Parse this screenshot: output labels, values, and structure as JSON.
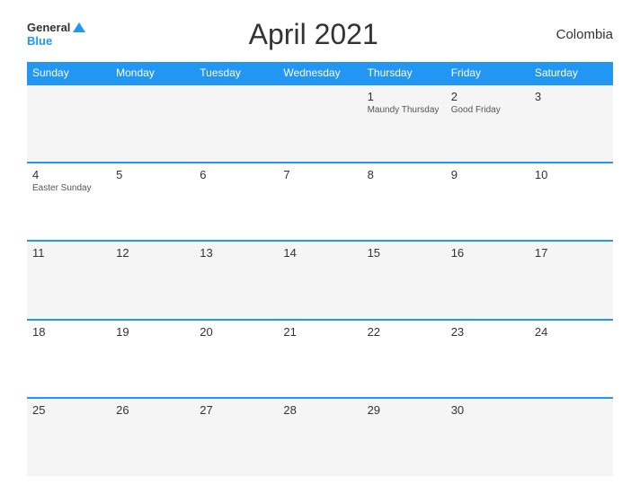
{
  "header": {
    "logo_general": "General",
    "logo_blue": "Blue",
    "title": "April 2021",
    "country": "Colombia"
  },
  "days_of_week": [
    "Sunday",
    "Monday",
    "Tuesday",
    "Wednesday",
    "Thursday",
    "Friday",
    "Saturday"
  ],
  "weeks": [
    [
      {
        "num": "",
        "holiday": ""
      },
      {
        "num": "",
        "holiday": ""
      },
      {
        "num": "",
        "holiday": ""
      },
      {
        "num": "",
        "holiday": ""
      },
      {
        "num": "1",
        "holiday": "Maundy Thursday"
      },
      {
        "num": "2",
        "holiday": "Good Friday"
      },
      {
        "num": "3",
        "holiday": ""
      }
    ],
    [
      {
        "num": "4",
        "holiday": "Easter Sunday"
      },
      {
        "num": "5",
        "holiday": ""
      },
      {
        "num": "6",
        "holiday": ""
      },
      {
        "num": "7",
        "holiday": ""
      },
      {
        "num": "8",
        "holiday": ""
      },
      {
        "num": "9",
        "holiday": ""
      },
      {
        "num": "10",
        "holiday": ""
      }
    ],
    [
      {
        "num": "11",
        "holiday": ""
      },
      {
        "num": "12",
        "holiday": ""
      },
      {
        "num": "13",
        "holiday": ""
      },
      {
        "num": "14",
        "holiday": ""
      },
      {
        "num": "15",
        "holiday": ""
      },
      {
        "num": "16",
        "holiday": ""
      },
      {
        "num": "17",
        "holiday": ""
      }
    ],
    [
      {
        "num": "18",
        "holiday": ""
      },
      {
        "num": "19",
        "holiday": ""
      },
      {
        "num": "20",
        "holiday": ""
      },
      {
        "num": "21",
        "holiday": ""
      },
      {
        "num": "22",
        "holiday": ""
      },
      {
        "num": "23",
        "holiday": ""
      },
      {
        "num": "24",
        "holiday": ""
      }
    ],
    [
      {
        "num": "25",
        "holiday": ""
      },
      {
        "num": "26",
        "holiday": ""
      },
      {
        "num": "27",
        "holiday": ""
      },
      {
        "num": "28",
        "holiday": ""
      },
      {
        "num": "29",
        "holiday": ""
      },
      {
        "num": "30",
        "holiday": ""
      },
      {
        "num": "",
        "holiday": ""
      }
    ]
  ]
}
